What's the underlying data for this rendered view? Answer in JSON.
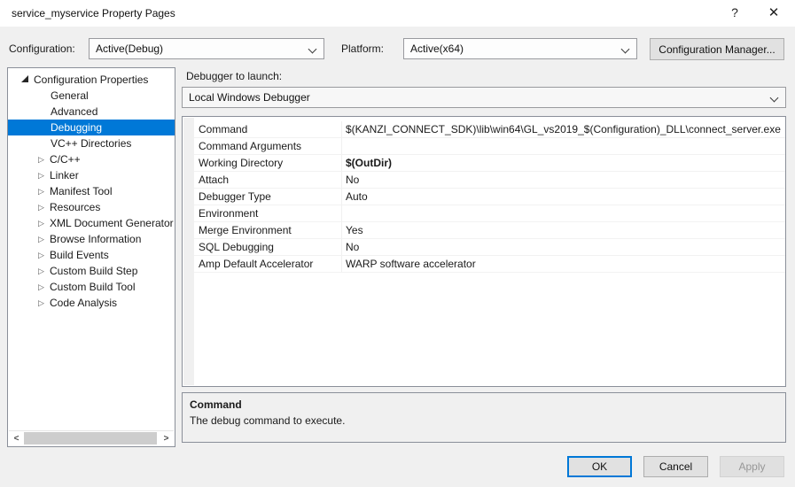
{
  "window": {
    "title": "service_myservice Property Pages"
  },
  "icons": {
    "help_glyph": "?",
    "close_glyph": "✕",
    "collapsed_glyph": "▷",
    "scroll_left_glyph": "<",
    "scroll_right_glyph": ">"
  },
  "toolbar": {
    "configuration_label": "Configuration:",
    "configuration_value": "Active(Debug)",
    "platform_label": "Platform:",
    "platform_value": "Active(x64)",
    "config_manager_button": "Configuration Manager..."
  },
  "tree": {
    "root_label": "Configuration Properties",
    "items": [
      {
        "label": "General",
        "type": "leaf",
        "selected": false
      },
      {
        "label": "Advanced",
        "type": "leaf",
        "selected": false
      },
      {
        "label": "Debugging",
        "type": "leaf",
        "selected": true
      },
      {
        "label": "VC++ Directories",
        "type": "leaf",
        "selected": false
      },
      {
        "label": "C/C++",
        "type": "collapsed",
        "selected": false
      },
      {
        "label": "Linker",
        "type": "collapsed",
        "selected": false
      },
      {
        "label": "Manifest Tool",
        "type": "collapsed",
        "selected": false
      },
      {
        "label": "Resources",
        "type": "collapsed",
        "selected": false
      },
      {
        "label": "XML Document Generator",
        "type": "collapsed",
        "selected": false
      },
      {
        "label": "Browse Information",
        "type": "collapsed",
        "selected": false
      },
      {
        "label": "Build Events",
        "type": "collapsed",
        "selected": false
      },
      {
        "label": "Custom Build Step",
        "type": "collapsed",
        "selected": false
      },
      {
        "label": "Custom Build Tool",
        "type": "collapsed",
        "selected": false
      },
      {
        "label": "Code Analysis",
        "type": "collapsed",
        "selected": false
      }
    ]
  },
  "debugger": {
    "label": "Debugger to launch:",
    "value": "Local Windows Debugger"
  },
  "grid": {
    "rows": [
      {
        "label": "Command",
        "value": "$(KANZI_CONNECT_SDK)\\lib\\win64\\GL_vs2019_$(Configuration)_DLL\\connect_server.exe"
      },
      {
        "label": "Command Arguments",
        "value": ""
      },
      {
        "label": "Working Directory",
        "value": "$(OutDir)"
      },
      {
        "label": "Attach",
        "value": "No"
      },
      {
        "label": "Debugger Type",
        "value": "Auto"
      },
      {
        "label": "Environment",
        "value": ""
      },
      {
        "label": "Merge Environment",
        "value": "Yes"
      },
      {
        "label": "SQL Debugging",
        "value": "No"
      },
      {
        "label": "Amp Default Accelerator",
        "value": "WARP software accelerator"
      }
    ]
  },
  "description": {
    "title": "Command",
    "text": "The debug command to execute."
  },
  "footer": {
    "ok": "OK",
    "cancel": "Cancel",
    "apply": "Apply"
  },
  "colors": {
    "selection": "#0078d7",
    "accent": "#0078d7",
    "dialog_background": "#f0f0f0"
  }
}
